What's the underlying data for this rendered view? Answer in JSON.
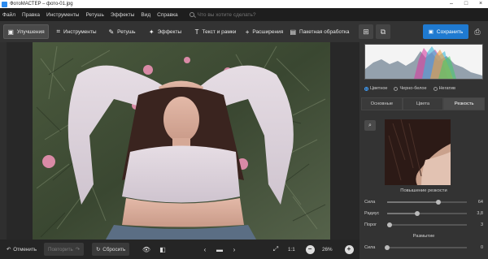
{
  "window": {
    "title": "ФотоМАСТЕР – фото-01.jpg"
  },
  "menu": {
    "items": [
      "Файл",
      "Правка",
      "Инструменты",
      "Ретушь",
      "Эффекты",
      "Вид",
      "Справка"
    ],
    "search_placeholder": "Что вы хотите сделать?"
  },
  "toolbar": {
    "tabs": [
      "Улучшения",
      "Инструменты",
      "Ретушь",
      "Эффекты",
      "Текст и рамки",
      "Расширения",
      "Пакетная обработка"
    ],
    "save_label": "Сохранить"
  },
  "panel": {
    "color_modes": [
      "Цветное",
      "Черно-белое",
      "Негатив"
    ],
    "tabs": [
      "Основные",
      "Цвета",
      "Резкость"
    ],
    "sharpen_title": "Повышение резкости",
    "sharpen_params": [
      {
        "label": "Сила",
        "value": "64",
        "fraction": 0.64
      },
      {
        "label": "Радиус",
        "value": "3,8",
        "fraction": 0.38
      },
      {
        "label": "Порог",
        "value": "3",
        "fraction": 0.03
      }
    ],
    "blur_title": "Размытие",
    "blur_params": [
      {
        "label": "Сила",
        "value": "0",
        "fraction": 0.0
      }
    ]
  },
  "bottombar": {
    "undo_label": "Отменить",
    "redo_label": "Повторить",
    "reset_label": "Сбросить",
    "fit_label": "1:1",
    "zoom_label": "26%"
  },
  "colors": {
    "accent": "#1f7ad1",
    "panel": "#333333",
    "menubar": "#1e1e1e"
  }
}
